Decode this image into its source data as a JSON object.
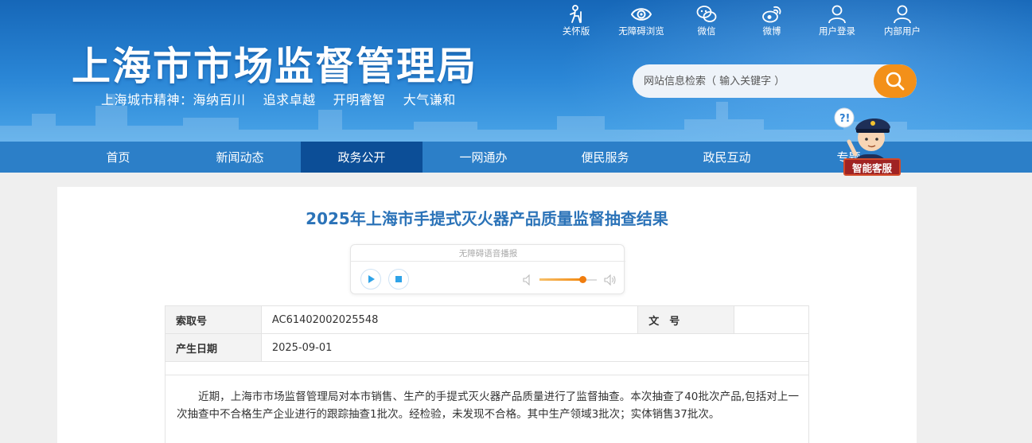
{
  "header": {
    "site_title": "上海市市场监督管理局",
    "slogan": "上海城市精神：海纳百川　 追求卓越　 开明睿智　 大气谦和",
    "top_links": [
      {
        "label": "关怀版",
        "icon": "elder-care-icon"
      },
      {
        "label": "无障碍浏览",
        "icon": "eye-icon"
      },
      {
        "label": "微信",
        "icon": "wechat-icon"
      },
      {
        "label": "微博",
        "icon": "weibo-icon"
      },
      {
        "label": "用户登录",
        "icon": "user-icon"
      },
      {
        "label": "内部用户",
        "icon": "user-icon"
      }
    ],
    "search": {
      "placeholder": "网站信息检索（ 输入关键字 ）",
      "button_icon": "search-icon"
    }
  },
  "nav": {
    "items": [
      "首页",
      "新闻动态",
      "政务公开",
      "一网通办",
      "便民服务",
      "政民互动",
      "专题"
    ],
    "active": "政务公开"
  },
  "assistant": {
    "label": "智能客服",
    "icon": "robot-officer-icon"
  },
  "article": {
    "title": "2025年上海市手提式灭火器产品质量监督抽查结果",
    "player": {
      "title": "无障碍语音播报",
      "volume_level": 0.75
    },
    "meta": {
      "index_label": "索取号",
      "index_value": "AC61402002025548",
      "doc_label": "文　号",
      "doc_value": "",
      "date_label": "产生日期",
      "date_value": "2025-09-01"
    },
    "paragraph": "近期，上海市市场监督管理局对本市销售、生产的手提式灭火器产品质量进行了监督抽查。本次抽查了40批次产品,包括对上一次抽查中不合格生产企业进行的跟踪抽查1批次。经检验，未发现不合格。其中生产领域3批次；实体销售37批次。"
  },
  "colors": {
    "header_blue": "#2a86d6",
    "nav_blue": "#2c7fc8",
    "nav_active": "#0c4e97",
    "title_blue": "#2b73b8",
    "search_orange": "#f39019"
  }
}
